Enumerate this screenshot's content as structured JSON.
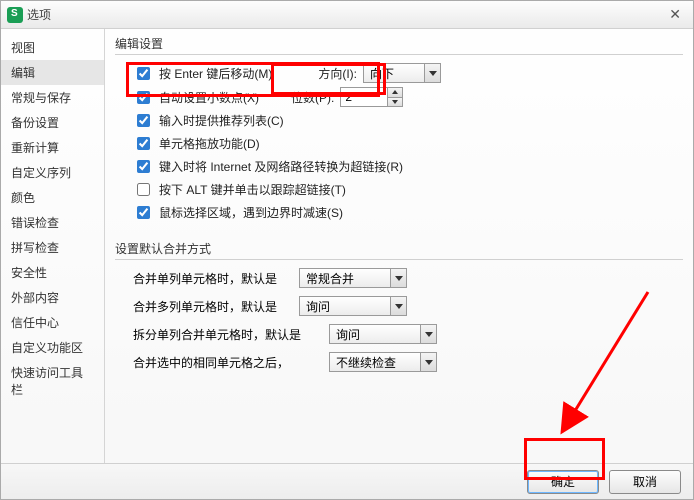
{
  "window": {
    "title": "选项"
  },
  "sidebar": {
    "items": [
      {
        "label": "视图"
      },
      {
        "label": "编辑",
        "selected": true
      },
      {
        "label": "常规与保存"
      },
      {
        "label": "备份设置"
      },
      {
        "label": "重新计算"
      },
      {
        "label": "自定义序列"
      },
      {
        "label": "颜色"
      },
      {
        "label": "错误检查"
      },
      {
        "label": "拼写检查"
      },
      {
        "label": "安全性"
      },
      {
        "label": "外部内容"
      },
      {
        "label": "信任中心"
      },
      {
        "label": "自定义功能区"
      },
      {
        "label": "快速访问工具栏"
      }
    ]
  },
  "edit": {
    "section_title": "编辑设置",
    "enter_move": {
      "label": "按 Enter 键后移动(M)",
      "checked": true
    },
    "direction_label": "方向(I):",
    "direction_value": "向下",
    "auto_decimal": {
      "label": "自动设置小数点(X)",
      "checked": true
    },
    "places_label": "位数(P):",
    "places_value": "2",
    "input_suggest": {
      "label": "输入时提供推荐列表(C)",
      "checked": true
    },
    "drag_fill": {
      "label": "单元格拖放功能(D)",
      "checked": true
    },
    "url_link": {
      "label": "键入时将 Internet 及网络路径转换为超链接(R)",
      "checked": true
    },
    "alt_click": {
      "label": "按下 ALT 键并单击以跟踪超链接(T)",
      "checked": false
    },
    "mouse_select": {
      "label": "鼠标选择区域，遇到边界时减速(S)",
      "checked": true
    }
  },
  "merge": {
    "section_title": "设置默认合并方式",
    "row1_label": "合并单列单元格时，默认是",
    "row1_value": "常规合并",
    "row2_label": "合并多列单元格时，默认是",
    "row2_value": "询问",
    "row3_label": "拆分单列合并单元格时，默认是",
    "row3_value": "询问",
    "row4_label": "合并选中的相同单元格之后，",
    "row4_value": "不继续检查"
  },
  "footer": {
    "ok": "确定",
    "cancel": "取消"
  }
}
